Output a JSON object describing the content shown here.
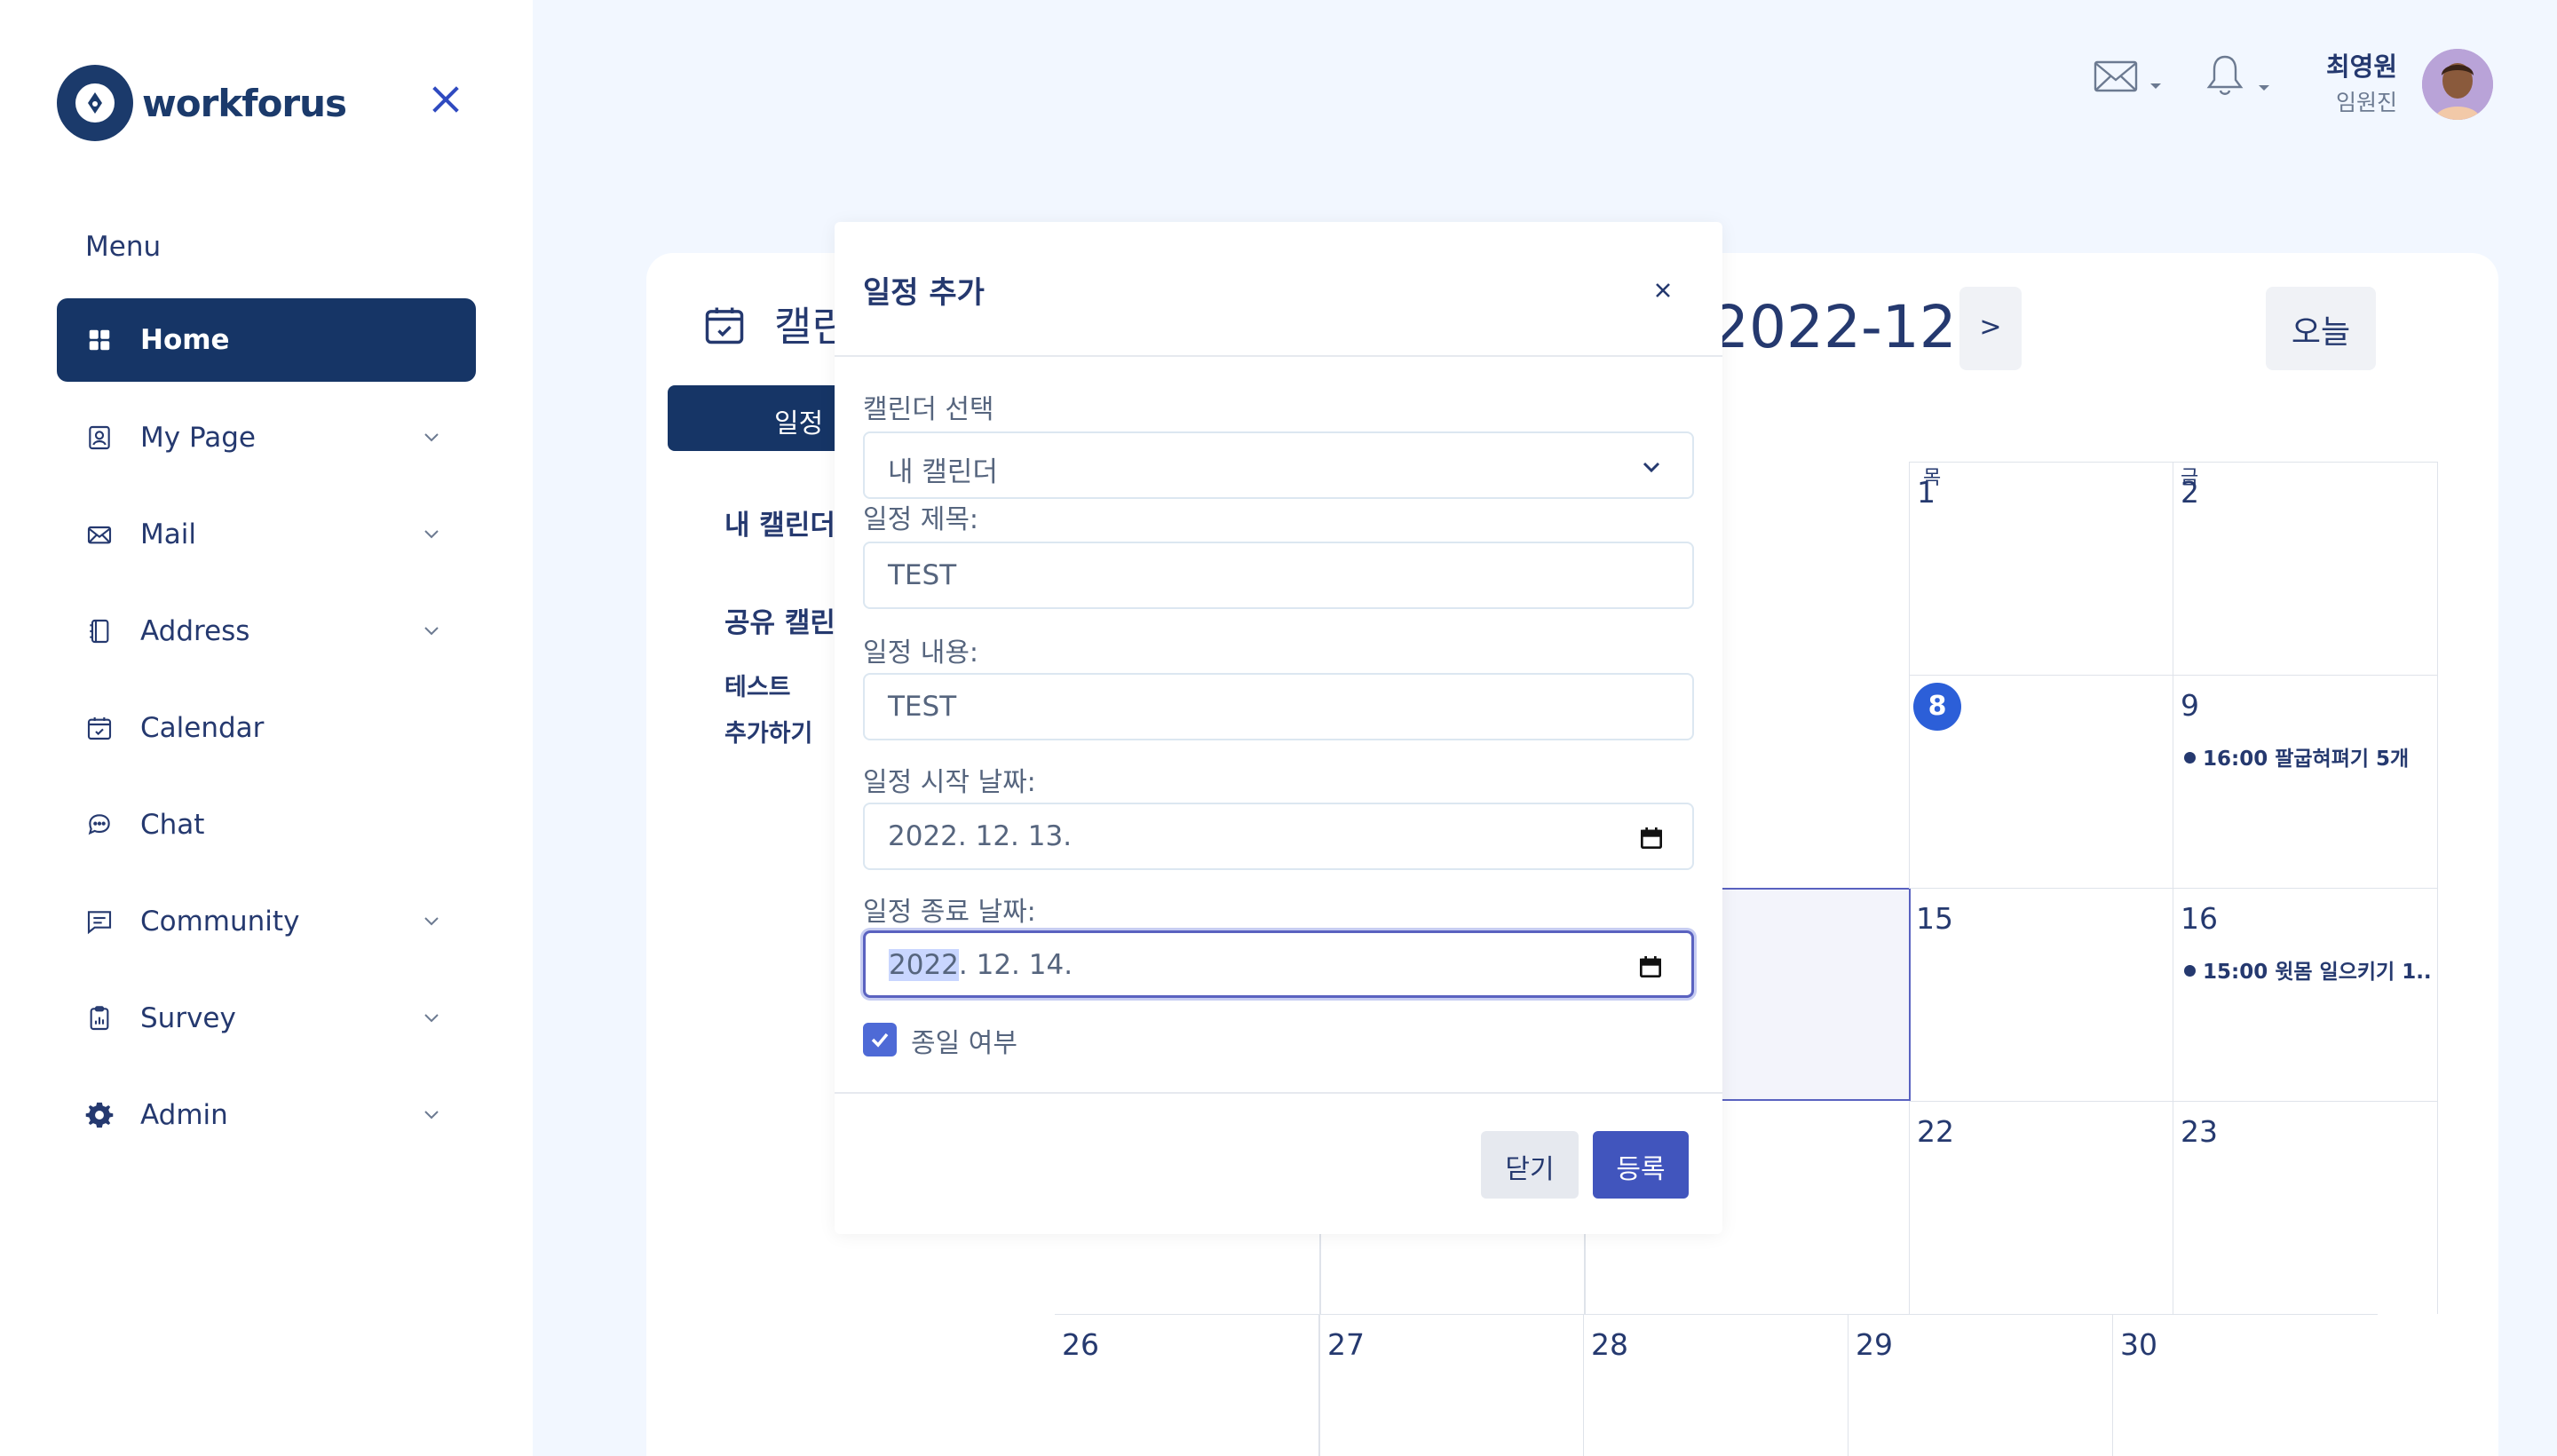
{
  "brand": {
    "name": "workforus"
  },
  "sidebar": {
    "menu_title": "Menu",
    "items": [
      {
        "label": "Home",
        "icon": "grid-icon",
        "active": true,
        "has_submenu": false
      },
      {
        "label": "My Page",
        "icon": "person-badge-icon",
        "active": false,
        "has_submenu": true
      },
      {
        "label": "Mail",
        "icon": "envelope-icon",
        "active": false,
        "has_submenu": true
      },
      {
        "label": "Address",
        "icon": "address-book-icon",
        "active": false,
        "has_submenu": true
      },
      {
        "label": "Calendar",
        "icon": "calendar-check-icon",
        "active": false,
        "has_submenu": false
      },
      {
        "label": "Chat",
        "icon": "chat-dots-icon",
        "active": false,
        "has_submenu": false
      },
      {
        "label": "Community",
        "icon": "message-square-icon",
        "active": false,
        "has_submenu": true
      },
      {
        "label": "Survey",
        "icon": "clipboard-chart-icon",
        "active": false,
        "has_submenu": true
      },
      {
        "label": "Admin",
        "icon": "gear-icon",
        "active": false,
        "has_submenu": true
      }
    ]
  },
  "topbar": {
    "user_name": "최영원",
    "user_role": "임원진"
  },
  "calendar_page": {
    "title": "캘린",
    "add_button": "일정",
    "my_calendar": "내 캘린더",
    "shared_calendar": "공유 캘린",
    "shared_items": [
      "테스트",
      "추가하기"
    ],
    "month": "2022-12",
    "next": ">",
    "today": "오늘",
    "weekdays": [
      "목",
      "금"
    ],
    "rows": [
      [
        {
          "day": "1"
        },
        {
          "day": "2"
        }
      ],
      [
        {
          "day": "8",
          "today": true
        },
        {
          "day": "9",
          "event": "16:00 팔굽혀펴기 5개"
        }
      ],
      [
        {
          "day": "15"
        },
        {
          "day": "16",
          "event": "15:00 윗몸 일으키기 1..."
        }
      ],
      [
        {
          "day": "22"
        },
        {
          "day": "23"
        }
      ]
    ],
    "last_row": [
      "26",
      "27",
      "28",
      "29",
      "30"
    ]
  },
  "modal": {
    "title": "일정 추가",
    "calendar_select_label": "캘린더 선택",
    "calendar_select_value": "내 캘린더",
    "title_label": "일정 제목:",
    "title_value": "TEST",
    "content_label": "일정 내용:",
    "content_value": "TEST",
    "start_label": "일정 시작 날짜:",
    "start_value": "2022. 12. 13.",
    "end_label": "일정 종료 날짜:",
    "end_year_selected": "2022",
    "end_value_rest": ". 12. 14.",
    "allday_label": "종일 여부",
    "allday_checked": true,
    "close_button": "닫기",
    "submit_button": "등록"
  },
  "colors": {
    "primary": "#163566",
    "accent": "#4155bd",
    "today": "#2c5fd8",
    "background": "#f2f7ff"
  }
}
